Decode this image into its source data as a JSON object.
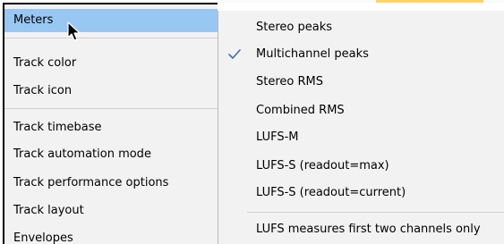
{
  "parent_menu": {
    "items": [
      {
        "label": "Meters"
      },
      {
        "label": "Track color"
      },
      {
        "label": "Track icon"
      },
      {
        "label": "Track timebase"
      },
      {
        "label": "Track automation mode"
      },
      {
        "label": "Track performance options"
      },
      {
        "label": "Track layout"
      },
      {
        "label": "Envelopes"
      }
    ],
    "highlight_color": "#99c7f3",
    "background": "#f2f2f2"
  },
  "submenu": {
    "items": [
      {
        "label": "Stereo peaks",
        "checked": false
      },
      {
        "label": "Multichannel peaks",
        "checked": true
      },
      {
        "label": "Stereo RMS",
        "checked": false
      },
      {
        "label": "Combined RMS",
        "checked": false
      },
      {
        "label": "LUFS-M",
        "checked": false
      },
      {
        "label": "LUFS-S (readout=max)",
        "checked": false
      },
      {
        "label": "LUFS-S (readout=current)",
        "checked": false
      },
      {
        "label": "LUFS measures first two channels only",
        "checked": false
      }
    ],
    "check_icon": "checkmark-icon",
    "check_color": "#3b6fb6"
  },
  "cursor_icon": "mouse-pointer-icon"
}
